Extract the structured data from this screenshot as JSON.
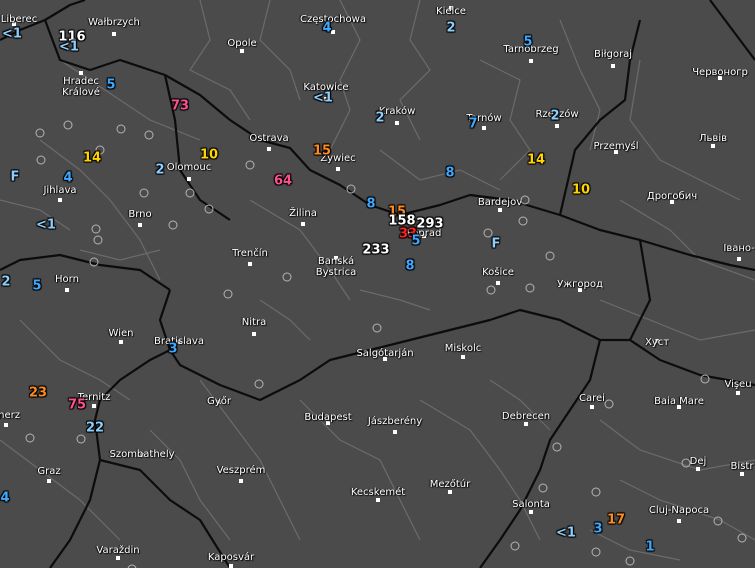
{
  "colors": {
    "background": "#4b4b4b",
    "border_country": "#0c0c0c",
    "border_region": "#6b6b6b",
    "city_text": "#ffffff",
    "station_ring": "#b4b4b4",
    "val_white": "#ffffff",
    "val_blue": "#3ea8ff",
    "val_lightblue": "#8ccfff",
    "val_yellow": "#ffd400",
    "val_orange": "#ff8a1f",
    "val_pink": "#ff4f8f",
    "val_red": "#ff2020"
  },
  "cities": [
    {
      "id": "liberec",
      "name": "Liberec"
    },
    {
      "id": "walbrzych",
      "name": "Wałbrzych"
    },
    {
      "id": "czestochowa",
      "name": "Częstochowa"
    },
    {
      "id": "kielce",
      "name": "Kielce"
    },
    {
      "id": "opole",
      "name": "Opole"
    },
    {
      "id": "tarnobrzeg",
      "name": "Tarnobrzeg"
    },
    {
      "id": "bilgoraj",
      "name": "Biłgoraj"
    },
    {
      "id": "chervonohrad",
      "name": "Червоногр"
    },
    {
      "id": "hradec",
      "name": "Hradec\nKrálové"
    },
    {
      "id": "katowice",
      "name": "Katowice"
    },
    {
      "id": "krakow",
      "name": "Kraków"
    },
    {
      "id": "tarnow",
      "name": "Tarnów"
    },
    {
      "id": "rzeszow",
      "name": "Rzeszów"
    },
    {
      "id": "lviv",
      "name": "Львів"
    },
    {
      "id": "ostrava",
      "name": "Ostrava"
    },
    {
      "id": "przemysl",
      "name": "Przemyśl"
    },
    {
      "id": "olomouc",
      "name": "Olomouc"
    },
    {
      "id": "zywiec",
      "name": "Żywiec"
    },
    {
      "id": "jihlava",
      "name": "Jihlava"
    },
    {
      "id": "drohobych",
      "name": "Дрогобич"
    },
    {
      "id": "bardejov",
      "name": "Bardejov"
    },
    {
      "id": "brno",
      "name": "Brno"
    },
    {
      "id": "zilina",
      "name": "Žilina"
    },
    {
      "id": "poprad",
      "name": "Poprad"
    },
    {
      "id": "trencin",
      "name": "Trenčín"
    },
    {
      "id": "banska",
      "name": "Banská\nBystrica"
    },
    {
      "id": "kosice",
      "name": "Košice"
    },
    {
      "id": "ivano",
      "name": "Івано-"
    },
    {
      "id": "uzhhorod",
      "name": "Ужгород"
    },
    {
      "id": "horn",
      "name": "Horn"
    },
    {
      "id": "nitra",
      "name": "Nitra"
    },
    {
      "id": "wien",
      "name": "Wien"
    },
    {
      "id": "bratislava",
      "name": "Bratislava"
    },
    {
      "id": "salgotarjan",
      "name": "Salgótarján"
    },
    {
      "id": "miskolc",
      "name": "Miskolc"
    },
    {
      "id": "khust",
      "name": "Хуст"
    },
    {
      "id": "ternitz",
      "name": "Ternitz"
    },
    {
      "id": "gyor",
      "name": "Győr"
    },
    {
      "id": "carei",
      "name": "Carei"
    },
    {
      "id": "viseu",
      "name": "Vişeu"
    },
    {
      "id": "baiamare",
      "name": "Baia Mare"
    },
    {
      "id": "enerz",
      "name": "enerz"
    },
    {
      "id": "budapest",
      "name": "Budapest"
    },
    {
      "id": "jaszbereny",
      "name": "Jászberény"
    },
    {
      "id": "debrecen",
      "name": "Debrecen"
    },
    {
      "id": "szombathely",
      "name": "Szombathely"
    },
    {
      "id": "dej",
      "name": "Dej"
    },
    {
      "id": "bistr",
      "name": "Bistr"
    },
    {
      "id": "graz",
      "name": "Graz"
    },
    {
      "id": "veszprem",
      "name": "Veszprém"
    },
    {
      "id": "kecskemet",
      "name": "Kecskemét"
    },
    {
      "id": "mezotur",
      "name": "Mezőtúr"
    },
    {
      "id": "salonta",
      "name": "Salonta"
    },
    {
      "id": "cluj",
      "name": "Cluj-Napoca"
    },
    {
      "id": "varazdin",
      "name": "Varaždin"
    },
    {
      "id": "kaposvar",
      "name": "Kaposvár"
    }
  ],
  "values": [
    {
      "text": "<1",
      "color": "val_lightblue"
    },
    {
      "text": "116",
      "color": "val_white"
    },
    {
      "text": "<1",
      "color": "val_lightblue"
    },
    {
      "text": "4",
      "color": "val_blue"
    },
    {
      "text": "2",
      "color": "val_lightblue"
    },
    {
      "text": "5",
      "color": "val_blue"
    },
    {
      "text": "5",
      "color": "val_blue"
    },
    {
      "text": "73",
      "color": "val_pink"
    },
    {
      "text": "<1",
      "color": "val_lightblue"
    },
    {
      "text": "2",
      "color": "val_lightblue"
    },
    {
      "text": "7",
      "color": "val_blue"
    },
    {
      "text": "2",
      "color": "val_lightblue"
    },
    {
      "text": "4",
      "color": "val_blue"
    },
    {
      "text": "14",
      "color": "val_yellow"
    },
    {
      "text": "2",
      "color": "val_lightblue"
    },
    {
      "text": "10",
      "color": "val_yellow"
    },
    {
      "text": "15",
      "color": "val_orange"
    },
    {
      "text": "14",
      "color": "val_yellow"
    },
    {
      "text": "F",
      "color": "val_lightblue"
    },
    {
      "text": "64",
      "color": "val_pink"
    },
    {
      "text": "8",
      "color": "val_blue"
    },
    {
      "text": "10",
      "color": "val_yellow"
    },
    {
      "text": "8",
      "color": "val_blue"
    },
    {
      "text": "15",
      "color": "val_orange"
    },
    {
      "text": "158",
      "color": "val_white"
    },
    {
      "text": "293",
      "color": "val_white"
    },
    {
      "text": "33",
      "color": "val_red"
    },
    {
      "text": "5",
      "color": "val_blue"
    },
    {
      "text": "<1",
      "color": "val_lightblue"
    },
    {
      "text": "233",
      "color": "val_white"
    },
    {
      "text": "F",
      "color": "val_lightblue"
    },
    {
      "text": "8",
      "color": "val_blue"
    },
    {
      "text": "2",
      "color": "val_lightblue"
    },
    {
      "text": "5",
      "color": "val_blue"
    },
    {
      "text": "3",
      "color": "val_blue"
    },
    {
      "text": "23",
      "color": "val_orange"
    },
    {
      "text": "75",
      "color": "val_pink"
    },
    {
      "text": "22",
      "color": "val_lightblue"
    },
    {
      "text": "4",
      "color": "val_blue"
    },
    {
      "text": "<1",
      "color": "val_lightblue"
    },
    {
      "text": "3",
      "color": "val_blue"
    },
    {
      "text": "17",
      "color": "val_orange"
    },
    {
      "text": "1",
      "color": "val_blue"
    }
  ]
}
